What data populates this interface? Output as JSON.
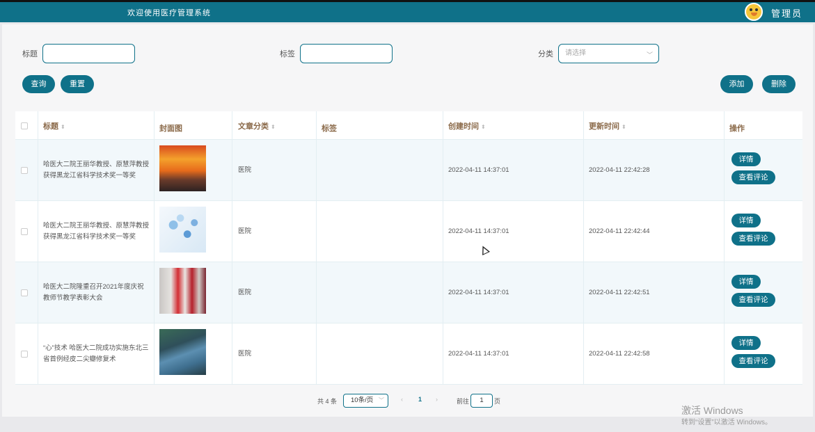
{
  "header": {
    "welcome": "欢迎使用医疗管理系统",
    "admin": "管理员"
  },
  "filters": {
    "title_label": "标题",
    "tag_label": "标签",
    "category_label": "分类",
    "category_placeholder": "请选择",
    "title_value": "",
    "tag_value": ""
  },
  "buttons": {
    "search": "查询",
    "reset": "重置",
    "add": "添加",
    "delete": "删除"
  },
  "table": {
    "columns": [
      "标题",
      "封面图",
      "文章分类",
      "标签",
      "创建时间",
      "更新时间",
      "操作"
    ],
    "rows": [
      {
        "title": "哈医大二院王丽华教授、原慧萍教授获得黑龙江省科学技术奖一等奖",
        "category": "医院",
        "tag": "",
        "created": "2022-04-11 14:37:01",
        "updated": "2022-04-11 22:42:28"
      },
      {
        "title": "哈医大二院王丽华教授、原慧萍教授获得黑龙江省科学技术奖一等奖",
        "category": "医院",
        "tag": "",
        "created": "2022-04-11 14:37:01",
        "updated": "2022-04-11 22:42:44"
      },
      {
        "title": "哈医大二院隆重召开2021年度庆祝教师节教学表彰大会",
        "category": "医院",
        "tag": "",
        "created": "2022-04-11 14:37:01",
        "updated": "2022-04-11 22:42:51"
      },
      {
        "title": "“心”技术 哈医大二院成功实施东北三省首例经皮二尖瓣修复术",
        "category": "医院",
        "tag": "",
        "created": "2022-04-11 14:37:01",
        "updated": "2022-04-11 22:42:58"
      }
    ],
    "detail_btn": "详情",
    "comment_btn": "查看评论"
  },
  "pagination": {
    "total": "共 4 条",
    "page_size": "10条/页",
    "current_page": "1",
    "goto_label": "前往",
    "goto_value": "1",
    "page_suffix": "页"
  },
  "watermark": {
    "line1": "激活 Windows",
    "line2": "转到“设置”以激活 Windows。"
  }
}
